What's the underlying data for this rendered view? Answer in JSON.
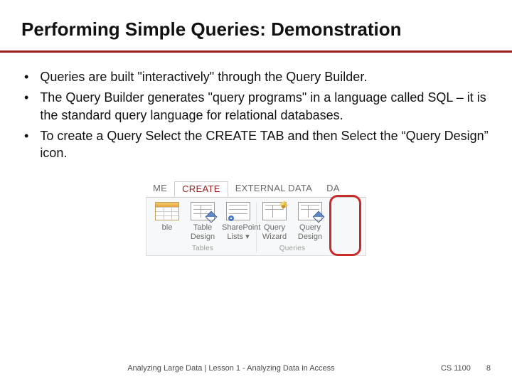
{
  "title": "Performing Simple Queries: Demonstration",
  "bullets": [
    "Queries are built \"interactively\" through the Query Builder.",
    "The Query Builder generates \"query programs\" in a language called SQL – it is the standard query language for relational databases.",
    "To create a Query Select the CREATE TAB and then Select the “Query Design” icon."
  ],
  "ribbon": {
    "tabs": {
      "left": "ME",
      "active": "CREATE",
      "right1": "EXTERNAL DATA",
      "right2": "DA"
    },
    "groups": {
      "tables": {
        "label": "Tables",
        "items": {
          "table": "ble",
          "tableDesign": "Table\nDesign",
          "sharepoint": "SharePoint\nLists ▾"
        }
      },
      "queries": {
        "label": "Queries",
        "items": {
          "wizard": "Query\nWizard",
          "design": "Query\nDesign"
        }
      }
    }
  },
  "footer": {
    "center": "Analyzing Large Data | Lesson 1 - Analyzing Data in Access",
    "course": "CS 1100",
    "page": "8"
  }
}
